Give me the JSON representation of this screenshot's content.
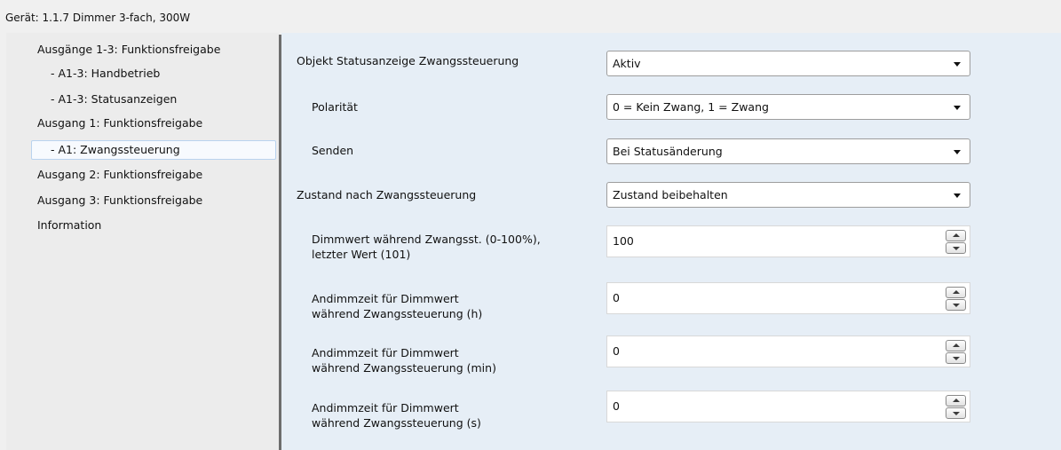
{
  "device": {
    "title": "Gerät: 1.1.7  Dimmer 3-fach, 300W"
  },
  "nav": {
    "items": [
      {
        "label": "Ausgänge 1-3: Funktionsfreigabe"
      },
      {
        "label": "- A1-3: Handbetrieb"
      },
      {
        "label": "- A1-3: Statusanzeigen"
      },
      {
        "label": "Ausgang 1: Funktionsfreigabe"
      },
      {
        "label": "- A1: Zwangssteuerung"
      },
      {
        "label": "Ausgang 2: Funktionsfreigabe"
      },
      {
        "label": "Ausgang 3: Funktionsfreigabe"
      },
      {
        "label": "Information"
      }
    ]
  },
  "params": {
    "status_object": {
      "label": "Objekt Statusanzeige Zwangssteuerung",
      "value": "Aktiv"
    },
    "polarity": {
      "label": "Polarität",
      "value": "0 = Kein Zwang, 1 = Zwang"
    },
    "send": {
      "label": "Senden",
      "value": "Bei Statusänderung"
    },
    "state_after": {
      "label": "Zustand nach Zwangssteuerung",
      "value": "Zustand beibehalten"
    },
    "dim_value": {
      "label_line1": "Dimmwert während Zwangsst. (0-100%),",
      "label_line2": "letzter Wert (101)",
      "value": "100"
    },
    "dim_time_h": {
      "label_line1": "Andimmzeit für Dimmwert",
      "label_line2": "während Zwangssteuerung (h)",
      "value": "0"
    },
    "dim_time_min": {
      "label_line1": "Andimmzeit für Dimmwert",
      "label_line2": "während Zwangssteuerung (min)",
      "value": "0"
    },
    "dim_time_s": {
      "label_line1": "Andimmzeit für Dimmwert",
      "label_line2": "während Zwangssteuerung (s)",
      "value": "0"
    }
  }
}
